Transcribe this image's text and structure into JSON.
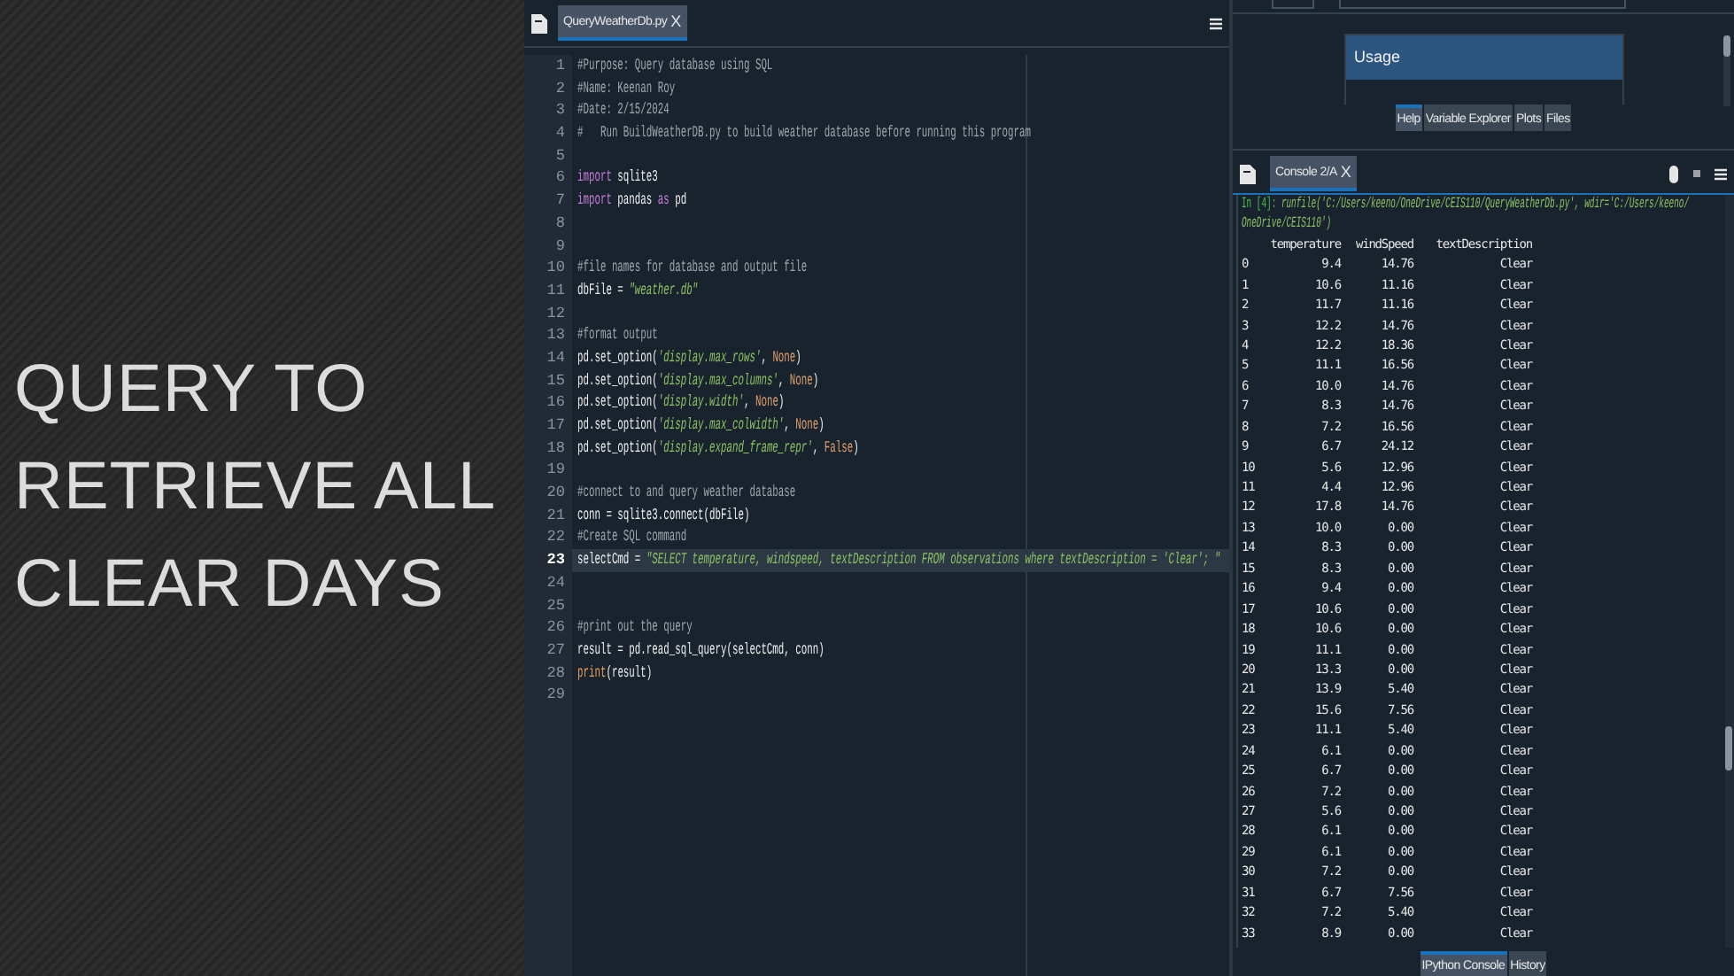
{
  "slide": {
    "title": "QUERY TO RETRIEVE ALL CLEAR DAYS"
  },
  "editor": {
    "tabs": [
      {
        "label": "QueryWeatherDb.py",
        "close": "X",
        "selected": true
      }
    ],
    "lines": [
      {
        "number": "1",
        "current": false,
        "tokens": [
          {
            "kind": "comment",
            "text": "#Purpose: Query database using SQL"
          }
        ]
      },
      {
        "number": "2",
        "current": false,
        "tokens": [
          {
            "kind": "comment",
            "text": "#Name: Keenan Roy"
          }
        ]
      },
      {
        "number": "3",
        "current": false,
        "tokens": [
          {
            "kind": "comment",
            "text": "#Date: 2/15/2024"
          }
        ]
      },
      {
        "number": "4",
        "current": false,
        "tokens": [
          {
            "kind": "comment",
            "text": "#   Run BuildWeatherDB.py to build weather database before running this program"
          }
        ]
      },
      {
        "number": "5",
        "current": false
      },
      {
        "number": "6",
        "current": false,
        "tokens": [
          {
            "kind": "keyword",
            "text": "import"
          },
          {
            "kind": "plain",
            "text": " sqlite3"
          }
        ]
      },
      {
        "number": "7",
        "current": false,
        "tokens": [
          {
            "kind": "keyword",
            "text": "import"
          },
          {
            "kind": "plain",
            "text": " pandas "
          },
          {
            "kind": "keyword",
            "text": "as"
          },
          {
            "kind": "plain",
            "text": " pd"
          }
        ]
      },
      {
        "number": "8",
        "current": false
      },
      {
        "number": "9",
        "current": false
      },
      {
        "number": "10",
        "current": false,
        "tokens": [
          {
            "kind": "comment",
            "text": "#file names for database and output file"
          }
        ]
      },
      {
        "number": "11",
        "current": false,
        "tokens": [
          {
            "kind": "plain",
            "text": "dbFile = "
          },
          {
            "kind": "string",
            "text": "\"weather.db\""
          }
        ]
      },
      {
        "number": "12",
        "current": false
      },
      {
        "number": "13",
        "current": false,
        "tokens": [
          {
            "kind": "comment",
            "text": "#format output"
          }
        ]
      },
      {
        "number": "14",
        "current": false,
        "tokens": [
          {
            "kind": "plain",
            "text": "pd.set_option("
          },
          {
            "kind": "string",
            "text": "'display.max_rows'"
          },
          {
            "kind": "plain",
            "text": ", "
          },
          {
            "kind": "constant",
            "text": "None"
          },
          {
            "kind": "plain",
            "text": ")"
          }
        ]
      },
      {
        "number": "15",
        "current": false,
        "tokens": [
          {
            "kind": "plain",
            "text": "pd.set_option("
          },
          {
            "kind": "string",
            "text": "'display.max_columns'"
          },
          {
            "kind": "plain",
            "text": ", "
          },
          {
            "kind": "constant",
            "text": "None"
          },
          {
            "kind": "plain",
            "text": ")"
          }
        ]
      },
      {
        "number": "16",
        "current": false,
        "tokens": [
          {
            "kind": "plain",
            "text": "pd.set_option("
          },
          {
            "kind": "string",
            "text": "'display.width'"
          },
          {
            "kind": "plain",
            "text": ", "
          },
          {
            "kind": "constant",
            "text": "None"
          },
          {
            "kind": "plain",
            "text": ")"
          }
        ]
      },
      {
        "number": "17",
        "current": false,
        "tokens": [
          {
            "kind": "plain",
            "text": "pd.set_option("
          },
          {
            "kind": "string",
            "text": "'display.max_colwidth'"
          },
          {
            "kind": "plain",
            "text": ", "
          },
          {
            "kind": "constant",
            "text": "None"
          },
          {
            "kind": "plain",
            "text": ")"
          }
        ]
      },
      {
        "number": "18",
        "current": false,
        "tokens": [
          {
            "kind": "plain",
            "text": "pd.set_option("
          },
          {
            "kind": "string",
            "text": "'display.expand_frame_repr'"
          },
          {
            "kind": "plain",
            "text": ", "
          },
          {
            "kind": "constant",
            "text": "False"
          },
          {
            "kind": "plain",
            "text": ")"
          }
        ]
      },
      {
        "number": "19",
        "current": false
      },
      {
        "number": "20",
        "current": false,
        "tokens": [
          {
            "kind": "comment",
            "text": "#connect to and query weather database"
          }
        ]
      },
      {
        "number": "21",
        "current": false,
        "tokens": [
          {
            "kind": "plain",
            "text": "conn = sqlite3.connect(dbFile)"
          }
        ]
      },
      {
        "number": "22",
        "current": false,
        "tokens": [
          {
            "kind": "comment",
            "text": "#Create SQL command"
          }
        ]
      },
      {
        "number": "23",
        "current": true,
        "tokens": [
          {
            "kind": "plain",
            "text": "selectCmd = "
          },
          {
            "kind": "string",
            "text": "\"SELECT temperature, windspeed, textDescription FROM observations where textDescription = 'Clear'; \""
          }
        ]
      },
      {
        "number": "24",
        "current": false
      },
      {
        "number": "25",
        "current": false
      },
      {
        "number": "26",
        "current": false,
        "tokens": [
          {
            "kind": "comment",
            "text": "#print out the query"
          }
        ]
      },
      {
        "number": "27",
        "current": false,
        "tokens": [
          {
            "kind": "plain",
            "text": "result = pd.read_sql_query(selectCmd, conn)"
          }
        ]
      },
      {
        "number": "28",
        "current": false,
        "tokens": [
          {
            "kind": "builtin",
            "text": "print"
          },
          {
            "kind": "plain",
            "text": "(result)"
          }
        ]
      },
      {
        "number": "29",
        "current": false
      }
    ]
  },
  "help_pane": {
    "heading": "Usage",
    "tabs": [
      {
        "label": "Help",
        "selected": true
      },
      {
        "label": "Variable Explorer",
        "selected": false
      },
      {
        "label": "Plots",
        "selected": false
      },
      {
        "label": "Files",
        "selected": false
      }
    ]
  },
  "console": {
    "tabs": [
      {
        "label": "Console 2/A",
        "close": "X",
        "selected": true
      }
    ],
    "prompt": "In [4]:",
    "command_lines": [
      " runfile('C:/Users/keeno/OneDrive/CEIS110/QueryWeatherDb.py', wdir='C:/Users/keeno/",
      "OneDrive/CEIS110')"
    ],
    "columns": [
      "",
      "temperature",
      "windSpeed",
      "textDescription"
    ],
    "rows": [
      [
        "0",
        "9.4",
        "14.76",
        "Clear"
      ],
      [
        "1",
        "10.6",
        "11.16",
        "Clear"
      ],
      [
        "2",
        "11.7",
        "11.16",
        "Clear"
      ],
      [
        "3",
        "12.2",
        "14.76",
        "Clear"
      ],
      [
        "4",
        "12.2",
        "18.36",
        "Clear"
      ],
      [
        "5",
        "11.1",
        "16.56",
        "Clear"
      ],
      [
        "6",
        "10.0",
        "14.76",
        "Clear"
      ],
      [
        "7",
        "8.3",
        "14.76",
        "Clear"
      ],
      [
        "8",
        "7.2",
        "16.56",
        "Clear"
      ],
      [
        "9",
        "6.7",
        "24.12",
        "Clear"
      ],
      [
        "10",
        "5.6",
        "12.96",
        "Clear"
      ],
      [
        "11",
        "4.4",
        "12.96",
        "Clear"
      ],
      [
        "12",
        "17.8",
        "14.76",
        "Clear"
      ],
      [
        "13",
        "10.0",
        "0.00",
        "Clear"
      ],
      [
        "14",
        "8.3",
        "0.00",
        "Clear"
      ],
      [
        "15",
        "8.3",
        "0.00",
        "Clear"
      ],
      [
        "16",
        "9.4",
        "0.00",
        "Clear"
      ],
      [
        "17",
        "10.6",
        "0.00",
        "Clear"
      ],
      [
        "18",
        "10.6",
        "0.00",
        "Clear"
      ],
      [
        "19",
        "11.1",
        "0.00",
        "Clear"
      ],
      [
        "20",
        "13.3",
        "0.00",
        "Clear"
      ],
      [
        "21",
        "13.9",
        "5.40",
        "Clear"
      ],
      [
        "22",
        "15.6",
        "7.56",
        "Clear"
      ],
      [
        "23",
        "11.1",
        "5.40",
        "Clear"
      ],
      [
        "24",
        "6.1",
        "0.00",
        "Clear"
      ],
      [
        "25",
        "6.7",
        "0.00",
        "Clear"
      ],
      [
        "26",
        "7.2",
        "0.00",
        "Clear"
      ],
      [
        "27",
        "5.6",
        "0.00",
        "Clear"
      ],
      [
        "28",
        "6.1",
        "0.00",
        "Clear"
      ],
      [
        "29",
        "6.1",
        "0.00",
        "Clear"
      ],
      [
        "30",
        "7.2",
        "0.00",
        "Clear"
      ],
      [
        "31",
        "6.7",
        "7.56",
        "Clear"
      ],
      [
        "32",
        "7.2",
        "5.40",
        "Clear"
      ],
      [
        "33",
        "8.9",
        "0.00",
        "Clear"
      ]
    ]
  },
  "bottom_tabs": [
    {
      "label": "IPython Console",
      "selected": true
    },
    {
      "label": "History",
      "selected": false
    }
  ]
}
